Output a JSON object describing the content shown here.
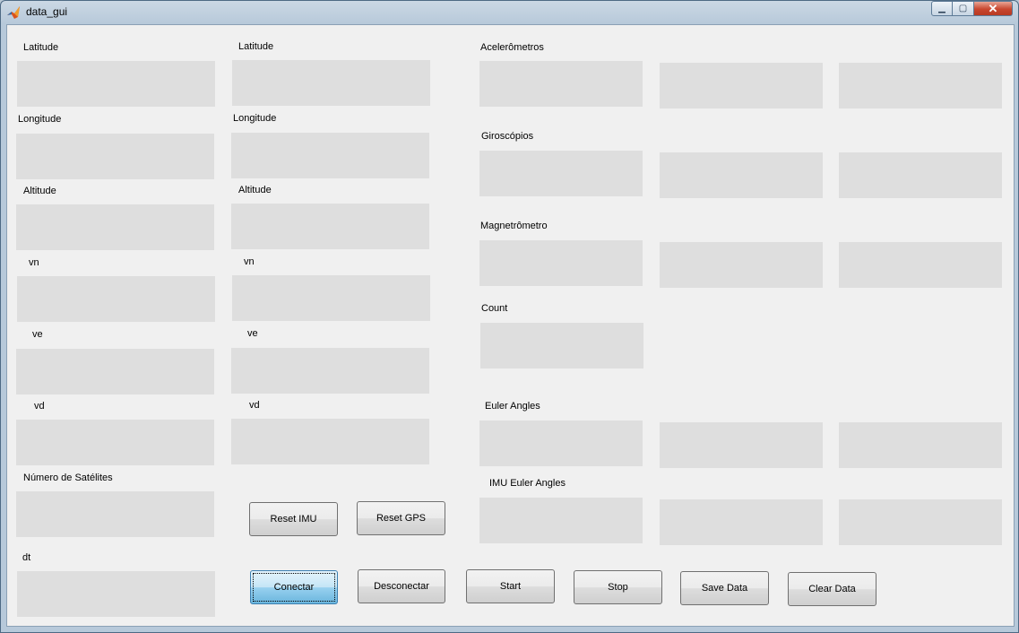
{
  "window": {
    "title": "data_gui"
  },
  "gps_col1": {
    "latitude": "Latitude",
    "longitude": "Longitude",
    "altitude": "Altitude",
    "vn": "vn",
    "ve": "ve",
    "vd": "vd",
    "satellites": "Número de Satélites",
    "dt": "dt"
  },
  "gps_col2": {
    "latitude": "Latitude",
    "longitude": "Longitude",
    "altitude": "Altitude",
    "vn": "vn",
    "ve": "ve",
    "vd": "vd"
  },
  "imu": {
    "accelerometers": "Acelerômetros",
    "gyroscopes": "Giroscópios",
    "magnetometer": "Magnetrômetro",
    "count": "Count",
    "euler_angles": "Euler Angles",
    "imu_euler_angles": "IMU Euler Angles"
  },
  "buttons": {
    "reset_imu": "Reset IMU",
    "reset_gps": "Reset GPS",
    "connect": "Conectar",
    "disconnect": "Desconectar",
    "start": "Start",
    "stop": "Stop",
    "save_data": "Save Data",
    "clear_data": "Clear Data"
  }
}
